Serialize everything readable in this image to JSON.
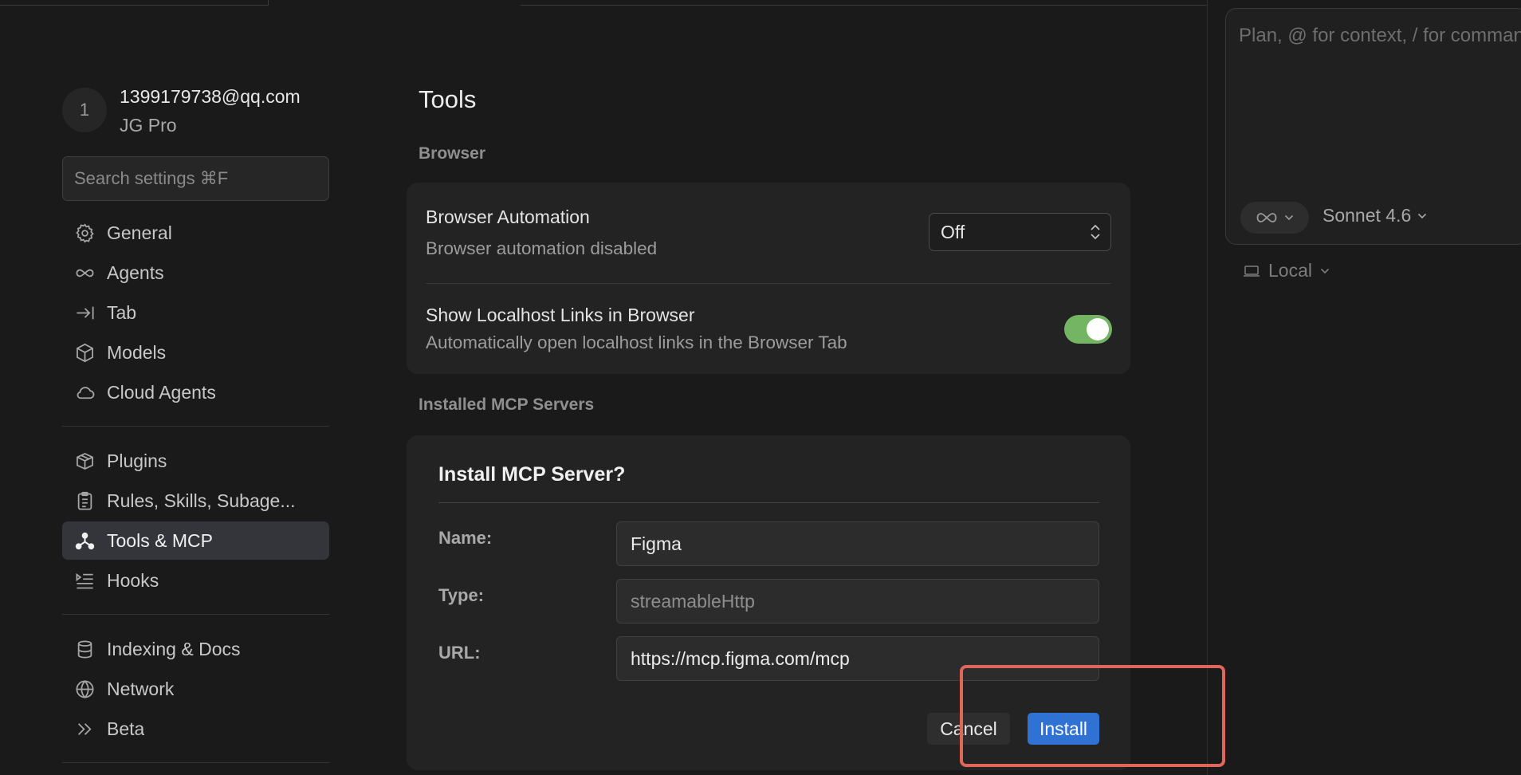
{
  "account": {
    "avatar_initial": "1",
    "email": "1399179738@qq.com",
    "plan": "JG Pro"
  },
  "search": {
    "placeholder": "Search settings ⌘F"
  },
  "sidebar": {
    "items": [
      {
        "label": "General",
        "icon": "gear-icon"
      },
      {
        "label": "Agents",
        "icon": "infinity-icon"
      },
      {
        "label": "Tab",
        "icon": "tab-arrow-icon"
      },
      {
        "label": "Models",
        "icon": "cube-icon"
      },
      {
        "label": "Cloud Agents",
        "icon": "cloud-icon"
      },
      {
        "label": "Plugins",
        "icon": "package-icon"
      },
      {
        "label": "Rules, Skills, Subage...",
        "icon": "clipboard-icon"
      },
      {
        "label": "Tools & MCP",
        "icon": "tools-network-icon",
        "active": true
      },
      {
        "label": "Hooks",
        "icon": "hooks-list-icon"
      },
      {
        "label": "Indexing & Docs",
        "icon": "database-icon"
      },
      {
        "label": "Network",
        "icon": "globe-icon"
      },
      {
        "label": "Beta",
        "icon": "double-chevron-icon"
      }
    ]
  },
  "main": {
    "title": "Tools",
    "browser_section": "Browser",
    "browser_automation": {
      "title": "Browser Automation",
      "description": "Browser automation disabled",
      "value": "Off"
    },
    "localhost_links": {
      "title": "Show Localhost Links in Browser",
      "description": "Automatically open localhost links in the Browser Tab",
      "enabled": true
    },
    "mcp_section": "Installed MCP Servers"
  },
  "dialog": {
    "title": "Install MCP Server?",
    "name_label": "Name:",
    "name_value": "Figma",
    "type_label": "Type:",
    "type_value": "streamableHttp",
    "url_label": "URL:",
    "url_value": "https://mcp.figma.com/mcp",
    "cancel_label": "Cancel",
    "install_label": "Install"
  },
  "composer": {
    "placeholder": "Plan, @ for context, / for commands",
    "mode_icon": "infinity-icon",
    "model": "Sonnet 4.6",
    "environment": "Local"
  },
  "colors": {
    "accent": "#2f72d4",
    "toggle_on": "#74b563",
    "annotation": "#e1665a"
  }
}
